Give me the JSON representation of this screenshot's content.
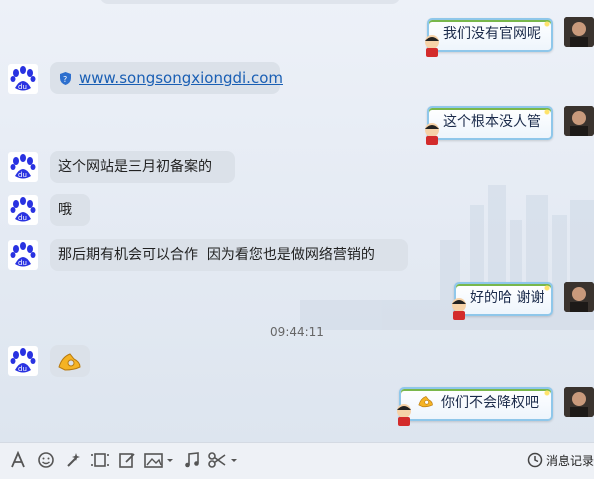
{
  "conversation": {
    "messages": [
      {
        "side": "right",
        "text": "我们没有官网呢"
      },
      {
        "side": "left",
        "type": "link",
        "text": "www.songsongxiongdi.com"
      },
      {
        "side": "right",
        "text": "这个根本没人管"
      },
      {
        "side": "left",
        "text": "这个网站是三月初备案的"
      },
      {
        "side": "left",
        "text": "哦"
      },
      {
        "side": "left",
        "text": "那后期有机会可以合作  因为看您也是做网络营销的"
      },
      {
        "side": "right",
        "text": "好的哈 谢谢"
      },
      {
        "side": "left",
        "type": "emoji",
        "emoji": "ok-hand"
      },
      {
        "side": "right",
        "text": "你们不会降权吧",
        "emoji": "ok-hand"
      }
    ],
    "timestamp": "09:44:11"
  },
  "toolbar": {
    "tools": [
      "font-icon",
      "emoji-face-icon",
      "magic-wand-icon",
      "screen-capture-icon",
      "edit-icon",
      "image-icon",
      "music-note-icon",
      "scissors-icon"
    ],
    "history_label": "消息记录"
  },
  "colors": {
    "bubble_left": "#dbe1e9",
    "bubble_right_border": "#8fc7ea",
    "link": "#1a5fb4",
    "baidu_blue": "#2932e1"
  }
}
